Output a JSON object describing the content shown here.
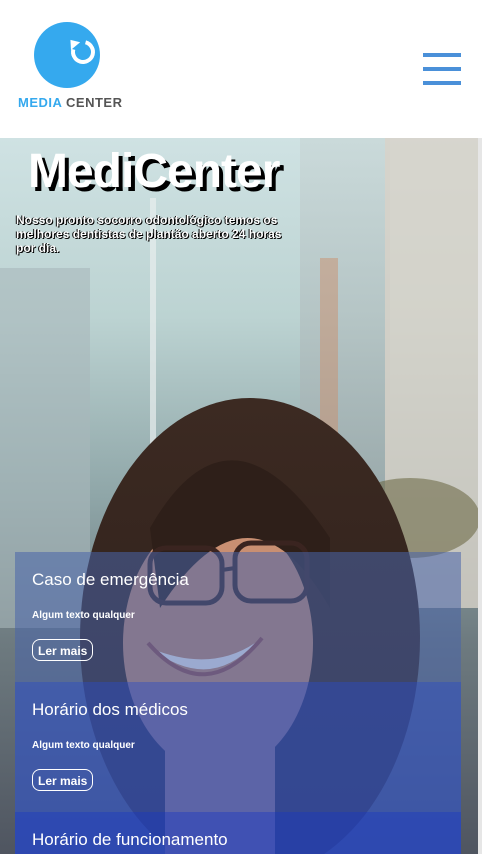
{
  "header": {
    "logo": {
      "word1": "MEDIA",
      "word2": "CENTER",
      "brand_color": "#35a9ee",
      "icon": "refresh-circle-icon"
    },
    "menu_icon": "hamburger-menu-icon"
  },
  "hero": {
    "title": "MediCenter",
    "description": "Nosso pronto socorro odontológico temos os melhores dentistas de plantão aberto 24 horas por dia."
  },
  "cards": [
    {
      "title": "Caso de emergência",
      "text": "Algum texto qualquer",
      "button": "Ler mais"
    },
    {
      "title": "Horário dos médicos",
      "text": "Algum texto qualquer",
      "button": "Ler mais"
    },
    {
      "title": "Horário de funcionamento"
    }
  ],
  "colors": {
    "menu": "#4a90d9",
    "card_blue": "#3755b9"
  }
}
